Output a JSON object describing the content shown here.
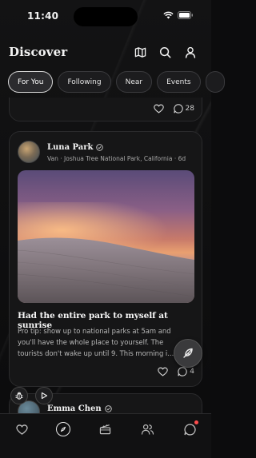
{
  "status_bar": {
    "time": "11:40"
  },
  "header": {
    "title": "Discover"
  },
  "filters": [
    {
      "label": "For You",
      "active": true
    },
    {
      "label": "Following",
      "active": false
    },
    {
      "label": "Near",
      "active": false
    },
    {
      "label": "Events",
      "active": false
    }
  ],
  "feed": {
    "previous_post": {
      "comment_count": "28"
    },
    "post": {
      "author": "Luna Park",
      "meta": "Van · Joshua Tree National Park, California · 6d",
      "title": "Had the entire park to myself at sunrise",
      "body": "Pro tip: show up to national parks at 5am and you'll have the whole place to yourself. The tourists don't wake up until 9. This morning i...",
      "comment_count": "4"
    },
    "next_post": {
      "author": "Emma Chen"
    }
  },
  "tabbar": {
    "items": [
      {
        "icon": "heart-icon"
      },
      {
        "icon": "compass-icon",
        "active": true
      },
      {
        "icon": "film-icon"
      },
      {
        "icon": "users-icon"
      },
      {
        "icon": "chat-icon",
        "badge": true
      }
    ]
  },
  "colors": {
    "background": "#0c0c0d",
    "card": "#161617",
    "badge": "#ff4d4d",
    "text": "#f2f2f2"
  }
}
